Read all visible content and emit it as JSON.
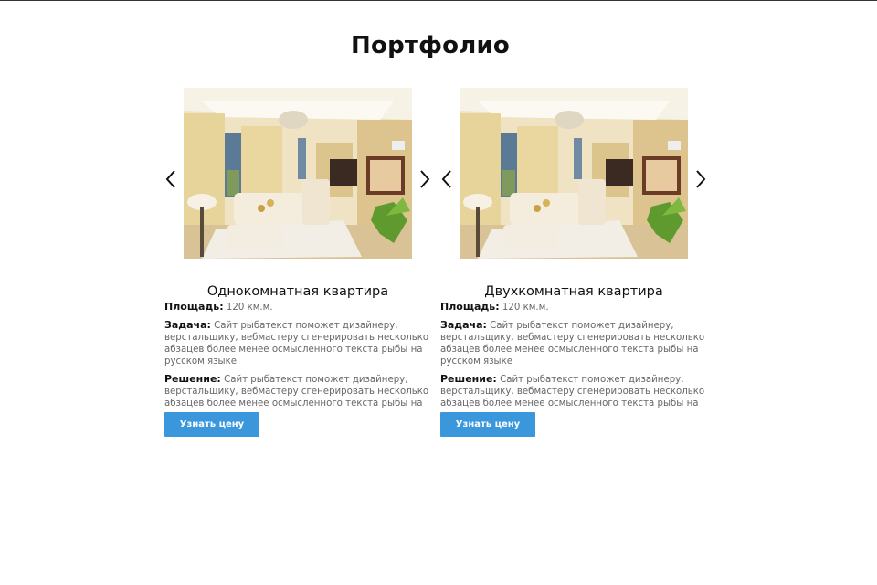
{
  "page": {
    "title": "Портфолио"
  },
  "portfolio": {
    "items": [
      {
        "title": "Однокомнатная квартира",
        "area_label": "Площадь:",
        "area_value": "120 км.м.",
        "task_label": "Задача:",
        "task_text": "Сайт рыбатекст поможет дизайнеру, верстальщику, вебмастеру сгенерировать несколько абзацев более менее осмысленного текста рыбы на русском языке",
        "solution_label": "Решение:",
        "solution_text": "Сайт рыбатекст поможет дизайнеру, верстальщику, вебмастеру сгенерировать несколько абзацев более менее осмысленного текста рыбы на русском языке",
        "button_label": "Узнать цену",
        "image_icon": "living-room-photo"
      },
      {
        "title": "Двухкомнатная квартира",
        "area_label": "Площадь:",
        "area_value": "120 км.м.",
        "task_label": "Задача:",
        "task_text": "Сайт рыбатекст поможет дизайнеру, верстальщику, вебмастеру сгенерировать несколько абзацев более менее осмысленного текста рыбы на русском языке",
        "solution_label": "Решение:",
        "solution_text": "Сайт рыбатекст поможет дизайнеру, верстальщику, вебмастеру сгенерировать несколько абзацев более менее осмысленного текста рыбы на русском языке",
        "button_label": "Узнать цену",
        "image_icon": "living-room-photo"
      }
    ]
  },
  "icons": {
    "prev": "chevron-left-icon",
    "next": "chevron-right-icon"
  },
  "colors": {
    "button": "#3a97dc",
    "title": "#111111",
    "body_text": "#666666"
  }
}
